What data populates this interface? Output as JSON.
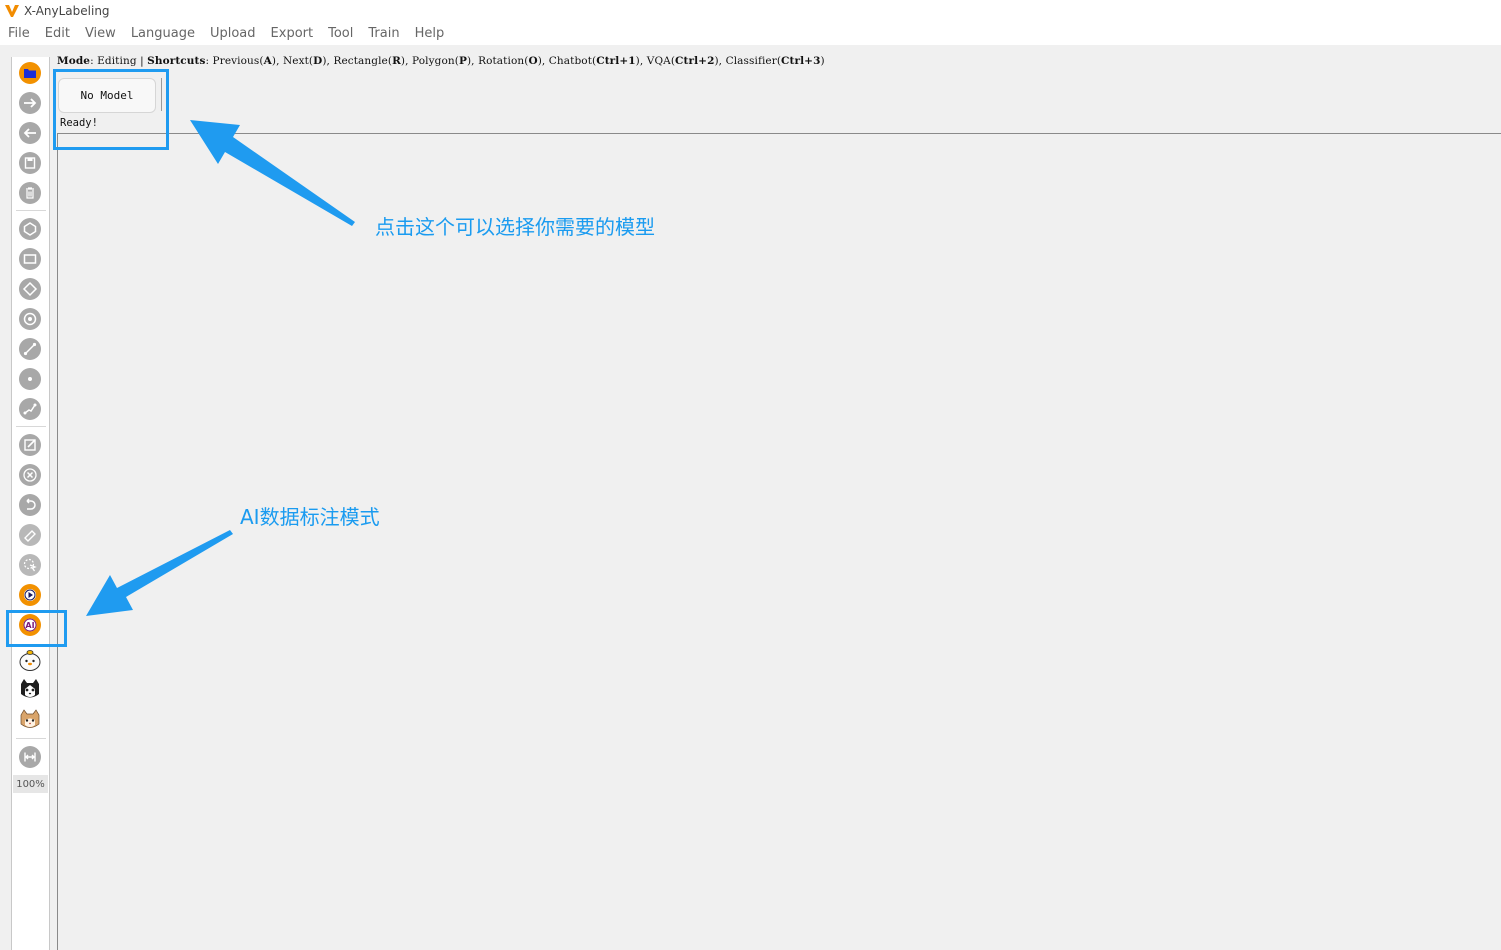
{
  "app": {
    "title": "X-AnyLabeling",
    "logo_color": "#f28c00"
  },
  "menu": {
    "items": [
      {
        "label": "File"
      },
      {
        "label": "Edit"
      },
      {
        "label": "View"
      },
      {
        "label": "Language"
      },
      {
        "label": "Upload"
      },
      {
        "label": "Export"
      },
      {
        "label": "Tool"
      },
      {
        "label": "Train"
      },
      {
        "label": "Help"
      }
    ]
  },
  "mode_bar": {
    "mode_key": "Mode",
    "mode_value": "Editing",
    "shortcuts_key": "Shortcuts",
    "shortcuts": [
      {
        "name": "Previous",
        "key": "A"
      },
      {
        "name": "Next",
        "key": "D"
      },
      {
        "name": "Rectangle",
        "key": "R"
      },
      {
        "name": "Polygon",
        "key": "P"
      },
      {
        "name": "Rotation",
        "key": "O"
      },
      {
        "name": "Chatbot",
        "key": "Ctrl+1"
      },
      {
        "name": "VQA",
        "key": "Ctrl+2"
      },
      {
        "name": "Classifier",
        "key": "Ctrl+3"
      }
    ]
  },
  "model": {
    "button_label": "No Model",
    "status": "Ready!"
  },
  "toolbar": {
    "tools": [
      {
        "name": "open-folder-icon",
        "interactable": true
      },
      {
        "name": "next-image-icon",
        "interactable": true
      },
      {
        "name": "previous-image-icon",
        "interactable": true
      },
      {
        "name": "save-icon",
        "interactable": true
      },
      {
        "name": "delete-file-icon",
        "interactable": true
      },
      {
        "name": "polygon-icon",
        "interactable": true
      },
      {
        "name": "rectangle-icon",
        "interactable": true
      },
      {
        "name": "rotation-icon",
        "interactable": true
      },
      {
        "name": "circle-icon",
        "interactable": true
      },
      {
        "name": "line-icon",
        "interactable": true
      },
      {
        "name": "point-icon",
        "interactable": true
      },
      {
        "name": "linestrip-icon",
        "interactable": true
      },
      {
        "name": "edit-icon",
        "interactable": true
      },
      {
        "name": "delete-shape-icon",
        "interactable": true
      },
      {
        "name": "undo-icon",
        "interactable": true
      },
      {
        "name": "brush-icon",
        "interactable": true
      },
      {
        "name": "select-cursor-icon",
        "interactable": true
      },
      {
        "name": "auto-run-icon",
        "interactable": true
      },
      {
        "name": "ai-mode-icon",
        "interactable": true
      },
      {
        "name": "chatbot-mascot-icon",
        "interactable": true
      },
      {
        "name": "vqa-mascot-icon",
        "interactable": true
      },
      {
        "name": "classifier-mascot-icon",
        "interactable": true
      },
      {
        "name": "fit-width-icon",
        "interactable": true
      }
    ],
    "zoom": "100%"
  },
  "annotations": {
    "model_hint": "点击这个可以选择你需要的模型",
    "ai_mode_hint": "AI数据标注模式",
    "color": "#1f9bf0"
  }
}
